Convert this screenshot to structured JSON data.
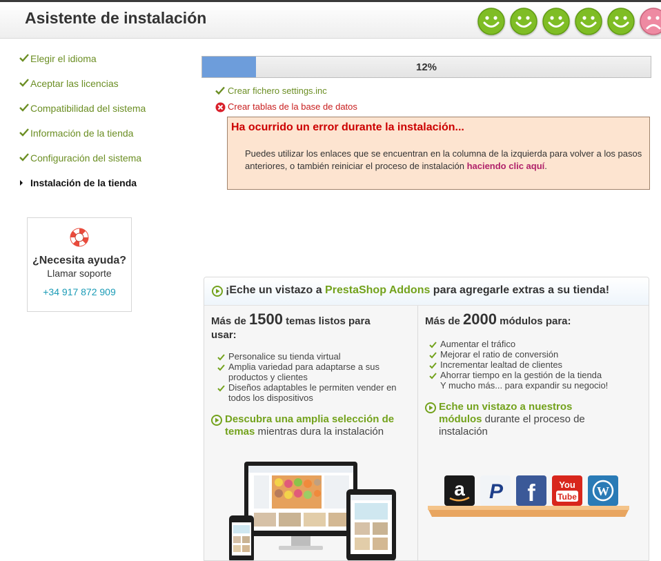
{
  "header": {
    "title": "Asistente de instalación"
  },
  "steps": [
    {
      "label": "Elegir el idioma",
      "status": "done"
    },
    {
      "label": "Aceptar las licencias",
      "status": "done"
    },
    {
      "label": "Compatibilidad del sistema",
      "status": "done"
    },
    {
      "label": "Información de la tienda",
      "status": "done"
    },
    {
      "label": "Configuración del sistema",
      "status": "done"
    },
    {
      "label": "Instalación de la tienda",
      "status": "current"
    }
  ],
  "help": {
    "title": "¿Necesita ayuda?",
    "subtitle": "Llamar soporte",
    "phone": "+34 917 872 909"
  },
  "progress": {
    "percent": 12,
    "label": "12%"
  },
  "tasks": [
    {
      "label": "Crear fichero settings.inc",
      "status": "ok"
    },
    {
      "label": "Crear tablas de la base de datos",
      "status": "error"
    }
  ],
  "error": {
    "title": "Ha ocurrido un error durante la instalación...",
    "message_line1": "Puedes utilizar los enlaces que se encuentran en la columna de la izquierda para volver a los pasos",
    "message_line2_prefix": "anteriores, o también reiniciar el proceso de instalación ",
    "link": "haciendo clic aquí",
    "message_suffix": "."
  },
  "addons": {
    "title_prefix": "¡Eche un vistazo a ",
    "brand": "PrestaShop Addons",
    "title_suffix": " para agregarle extras a su tienda!",
    "themes": {
      "head_prefix": "Más de ",
      "count": "1500",
      "head_suffix": " temas listos para",
      "head_line2": "usar:",
      "features": [
        [
          "Personalice su tienda virtual"
        ],
        [
          "Amplia variedad para adaptarse a sus",
          "productos y clientes"
        ],
        [
          "Diseños adaptables le permiten vender en",
          "todos los dispositivos"
        ]
      ],
      "cta_green_1": "Descubra una amplia selección de",
      "cta_green_2": "temas",
      "cta_rest": " mientras dura la instalación"
    },
    "modules": {
      "head_prefix": "Más de ",
      "count": "2000",
      "head_suffix": " módulos para:",
      "features": [
        "Aumentar el tráfico",
        "Mejorar el ratio de conversión",
        "Incrementar lealtad de clientes",
        "Ahorrar tiempo en la gestión de la tienda"
      ],
      "extra": "Y mucho más... para expandir su negocio!",
      "cta_green_1": "Eche un vistazo a nuestros",
      "cta_green_2": "módulos",
      "cta_rest_1": " durante el proceso de",
      "cta_rest_2": "instalación"
    },
    "logo_labels": [
      "You",
      "Tube"
    ]
  },
  "colors": {
    "accent_green": "#73a21c",
    "step_done": "#6b8e23",
    "error_red": "#cc0000",
    "progress_fill": "#6d9ddb",
    "error_bg": "#fde4d0",
    "link_purple": "#b0226a"
  }
}
